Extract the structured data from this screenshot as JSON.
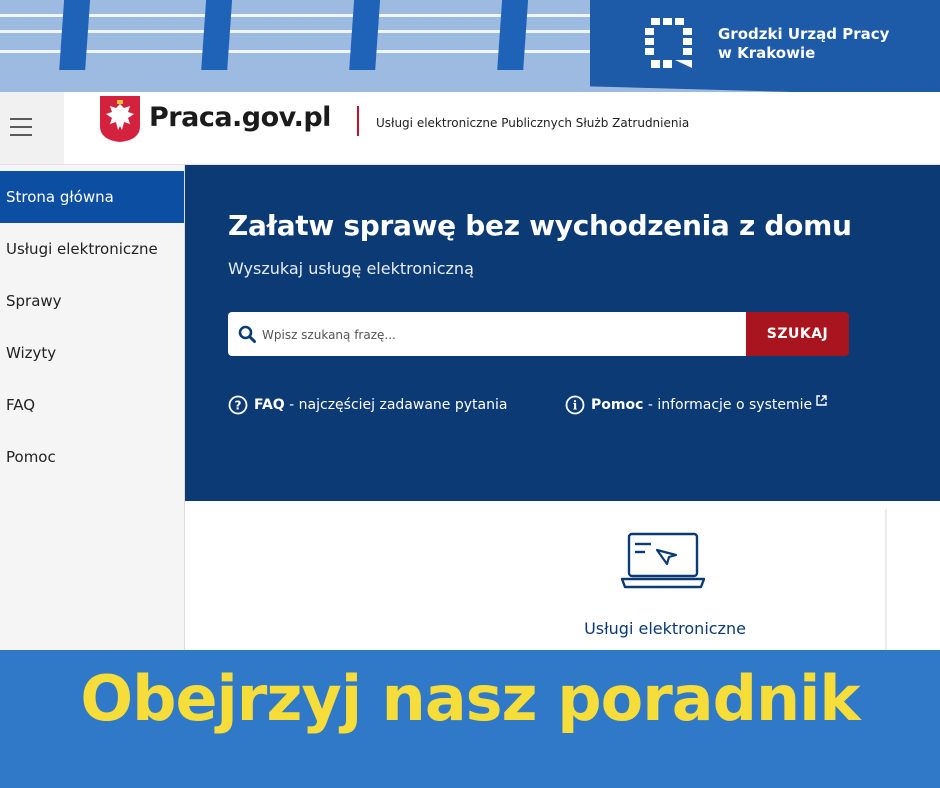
{
  "badge": {
    "line1": "Grodzki Urząd Pracy",
    "line2": "w Krakowie"
  },
  "header": {
    "brand": "Praca.gov.pl",
    "tagline": "Usługi elektroniczne Publicznych Służb Zatrudnienia"
  },
  "sidebar": {
    "items": [
      {
        "label": "Strona główna",
        "active": true
      },
      {
        "label": "Usługi elektroniczne"
      },
      {
        "label": "Sprawy"
      },
      {
        "label": "Wizyty"
      },
      {
        "label": "FAQ"
      },
      {
        "label": "Pomoc"
      }
    ]
  },
  "hero": {
    "title": "Załatw sprawę bez wychodzenia z domu",
    "subtitle": "Wyszukaj usługę elektroniczną",
    "search_placeholder": "Wpisz szukaną frazę...",
    "search_button": "SZUKAJ",
    "faq_strong": "FAQ",
    "faq_rest": " - najczęściej zadawane pytania",
    "help_strong": "Pomoc",
    "help_rest": " - informacje o systemie"
  },
  "card": {
    "label": "Usługi elektroniczne"
  },
  "banner": {
    "text": "Obejrzyj nasz poradnik"
  },
  "colors": {
    "primary": "#0b3a75",
    "nav_active": "#0b4ea2",
    "search_button": "#a8151f",
    "banner_bg": "#2f79c8",
    "banner_text": "#f7dd3a"
  },
  "icons": {
    "menu": "hamburger-icon",
    "logo": "polish-eagle-icon",
    "search": "search-icon",
    "faq": "question-circle-icon",
    "help": "info-circle-icon",
    "external": "external-link-icon",
    "card": "laptop-cursor-icon"
  }
}
